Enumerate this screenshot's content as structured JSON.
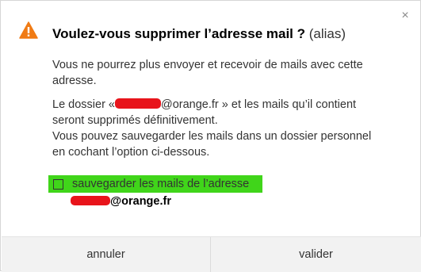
{
  "dialog": {
    "close_symbol": "×",
    "warning_icon": "warning-triangle-icon",
    "title_main": "Voulez-vous supprimer l’adresse mail ?",
    "title_sub": "(alias)",
    "paragraph1": "Vous ne pourrez plus envoyer et recevoir de mails avec cette adresse.",
    "paragraph2_prefix": "Le dossier «",
    "paragraph2_email_domain": "@orange.fr",
    "paragraph2_suffix": "» et les mails qu’il contient seront supprimés définitivement.",
    "paragraph2_line2": "Vous pouvez sauvegarder les mails dans un dossier personnel en cochant l’option ci-dessous.",
    "checkbox_label": "sauvegarder les mails de l’adresse",
    "checkbox_checked": false,
    "email_domain": "@orange.fr",
    "cancel_label": "annuler",
    "validate_label": "valider"
  },
  "colors": {
    "warning": "#f07b15",
    "highlight": "#40d51a",
    "redaction": "#e8141b"
  }
}
